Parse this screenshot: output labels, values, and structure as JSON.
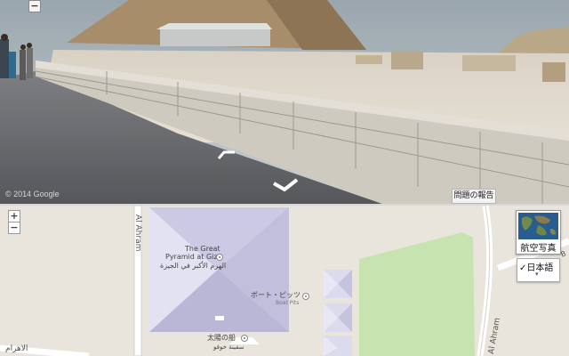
{
  "street_view": {
    "zoom_out_label": "−",
    "copyright": "© 2014 Google",
    "report_problem": "問題の報告"
  },
  "map": {
    "zoom_in_label": "+",
    "zoom_out_label": "−",
    "road_left": "Al Ahram",
    "road_right": "Al Ahram",
    "road_bottom_arabic": "الاهرام",
    "road_right_partial": "B",
    "poi_pyramid_en_1": "The Great",
    "poi_pyramid_en_2": "Pyramid at Giza",
    "poi_pyramid_ar": "الهرم الأكبر في الجيزة",
    "poi_boat_pits_jp": "ボート・ピッツ",
    "poi_boat_pits_en": "Boat Pits",
    "poi_solar_boat_jp": "太陽の船",
    "poi_solar_boat_ar": "سفينة خوفو",
    "satellite_toggle": "航空写真",
    "language_button": "✓日本語",
    "language_caret": "▾"
  },
  "colors": {
    "map_bg": "#e9e5dd",
    "park_green": "#c6e3b0",
    "pyramid_fill": "#d5d3e8",
    "road": "#ffffff"
  }
}
